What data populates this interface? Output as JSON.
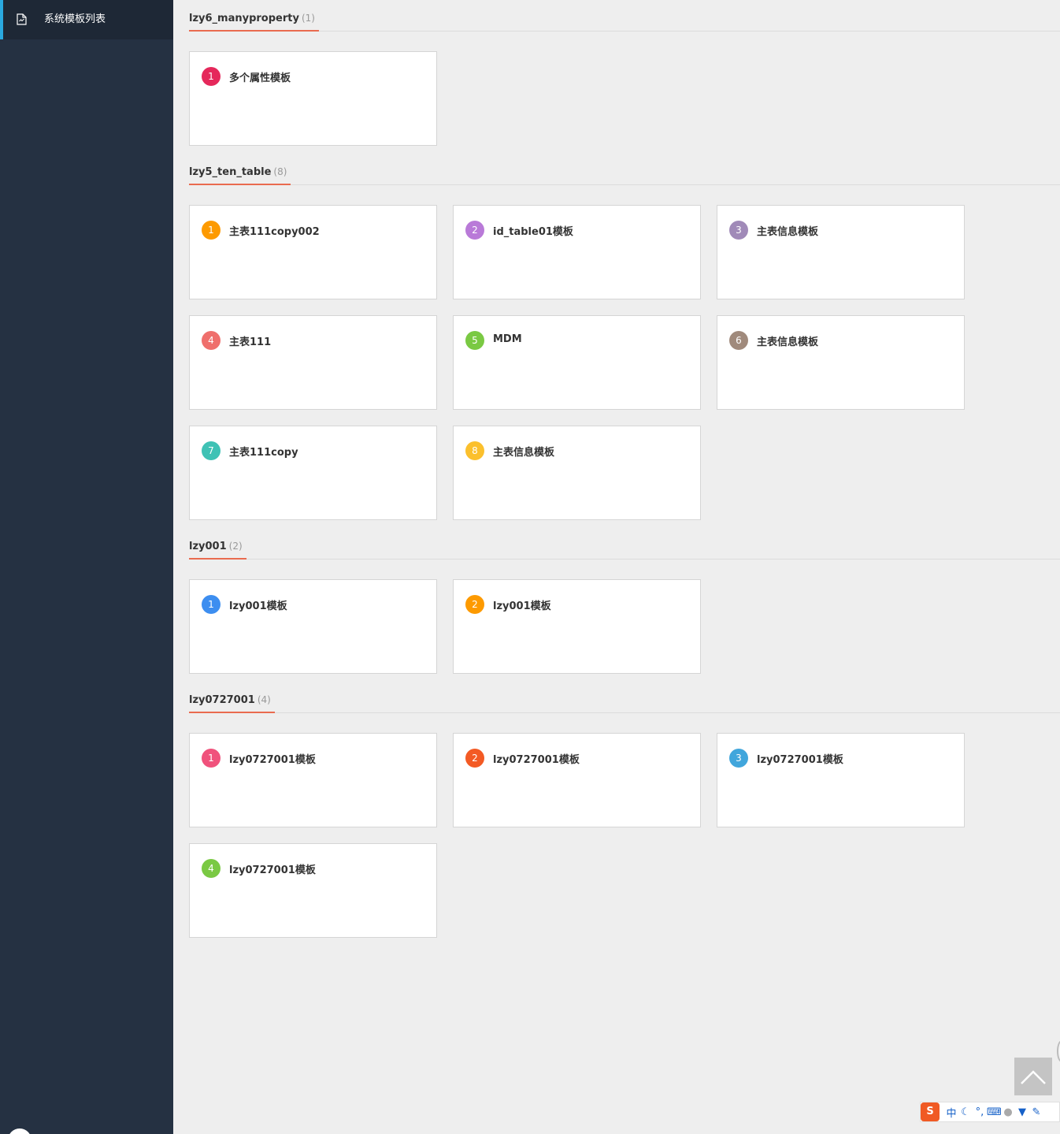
{
  "sidebar": {
    "items": [
      {
        "label": "系统模板列表",
        "icon": "document-icon",
        "active": true
      }
    ]
  },
  "sections": [
    {
      "title": "lzy6_manyproperty",
      "count": "(1)",
      "cards": [
        {
          "num": "1",
          "title": "多个属性模板",
          "color": "#e5285b"
        }
      ]
    },
    {
      "title": "lzy5_ten_table",
      "count": "(8)",
      "cards": [
        {
          "num": "1",
          "title": "主表111copy002",
          "color": "#fd9a00"
        },
        {
          "num": "2",
          "title": "id_table01模板",
          "color": "#b97ad8"
        },
        {
          "num": "3",
          "title": "主表信息模板",
          "color": "#a08ab8"
        },
        {
          "num": "4",
          "title": "主表111",
          "color": "#ef6f6c"
        },
        {
          "num": "5",
          "title": "MDM",
          "color": "#7ac943"
        },
        {
          "num": "6",
          "title": "主表信息模板",
          "color": "#a08a7c"
        },
        {
          "num": "7",
          "title": "主表111copy",
          "color": "#3fc2b5"
        },
        {
          "num": "8",
          "title": "主表信息模板",
          "color": "#fbc02d"
        }
      ]
    },
    {
      "title": "lzy001",
      "count": "(2)",
      "cards": [
        {
          "num": "1",
          "title": "lzy001模板",
          "color": "#3d8ef0"
        },
        {
          "num": "2",
          "title": "lzy001模板",
          "color": "#fd9a00"
        }
      ]
    },
    {
      "title": "lzy0727001",
      "count": "(4)",
      "cards": [
        {
          "num": "1",
          "title": "lzy0727001模板",
          "color": "#f0527c"
        },
        {
          "num": "2",
          "title": "lzy0727001模板",
          "color": "#f35a24"
        },
        {
          "num": "3",
          "title": "lzy0727001模板",
          "color": "#41a6dc"
        },
        {
          "num": "4",
          "title": "lzy0727001模板",
          "color": "#7ac943"
        }
      ]
    }
  ],
  "back_to_top": {
    "icon": "chevron-up-icon"
  },
  "ime_toolbar": {
    "logo": "S",
    "mode": "中",
    "icons": [
      "moon-icon",
      "punctuation-icon",
      "keyboard-icon",
      "user-icon",
      "shirt-icon",
      "wrench-icon"
    ]
  }
}
